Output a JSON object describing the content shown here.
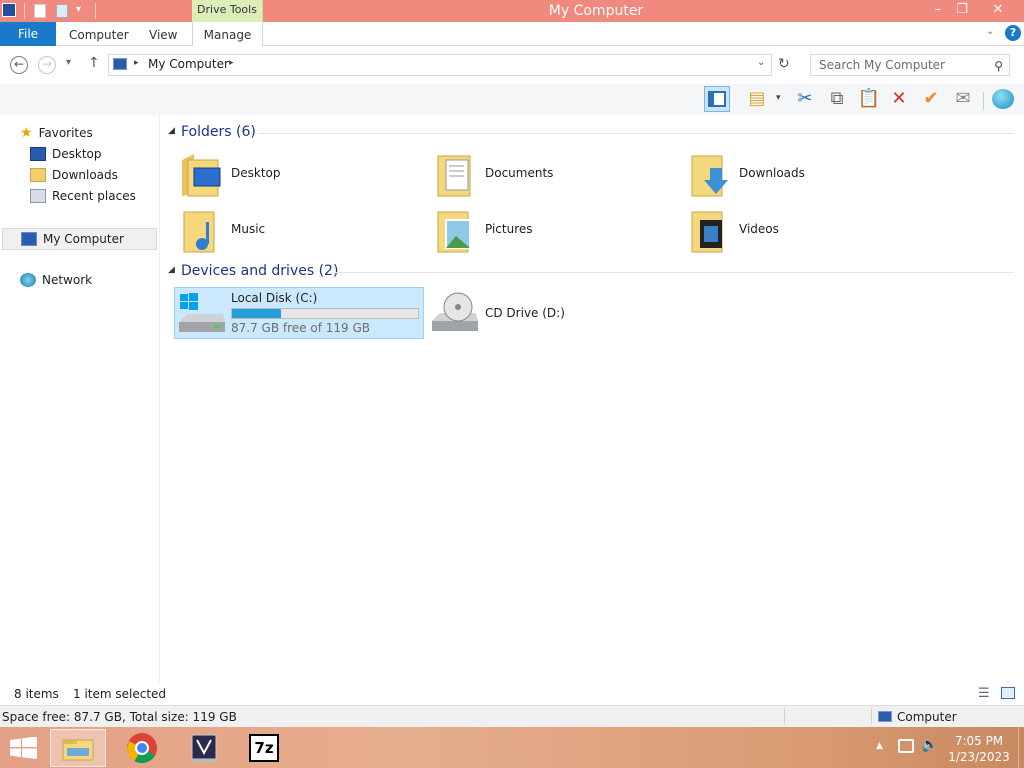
{
  "window": {
    "title": "My Computer",
    "contextual_tab": "Drive Tools",
    "minimize": "–",
    "maximize": "❐",
    "close": "✕"
  },
  "ribbon": {
    "file": "File",
    "tabs": [
      "Computer",
      "View",
      "Manage"
    ],
    "help": "?"
  },
  "address": {
    "path": "My Computer",
    "search_placeholder": "Search My Computer"
  },
  "sidebar": {
    "favorites": "Favorites",
    "items": [
      "Desktop",
      "Downloads",
      "Recent places"
    ],
    "computer": "My Computer",
    "network": "Network"
  },
  "groups": {
    "folders": "Folders (6)",
    "devices": "Devices and drives (2)"
  },
  "folders": [
    "Desktop",
    "Documents",
    "Downloads",
    "Music",
    "Pictures",
    "Videos"
  ],
  "drives": {
    "c": {
      "name": "Local Disk (C:)",
      "free_text": "87.7 GB free of 119 GB",
      "used_fraction": 0.263
    },
    "d": {
      "name": "CD Drive (D:)"
    }
  },
  "status": {
    "items": "8 items",
    "selected": "1 item selected",
    "space": "Space free: 87.7 GB, Total size: 119 GB",
    "location": "Computer"
  },
  "taskbar": {
    "time": "7:05 PM",
    "date": "1/23/2023",
    "sevenzip": "7z"
  },
  "colors": {
    "title_bg": "#f08a7e",
    "accent": "#1979ca",
    "selection": "#cce8ff",
    "progress": "#26a0da",
    "taskbar": "#e4a086"
  }
}
